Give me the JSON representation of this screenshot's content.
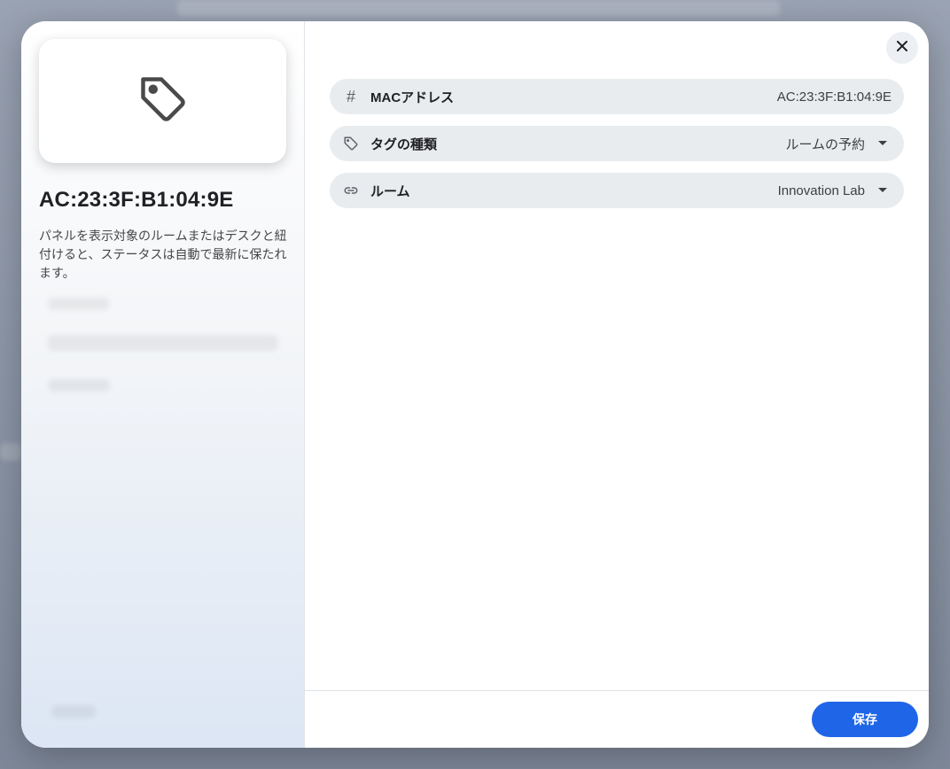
{
  "left": {
    "preview_icon": "tag-icon",
    "title": "AC:23:3F:B1:04:9E",
    "description": "パネルを表示対象のルームまたはデスクと紐付けると、ステータスは自動で最新に保たれます。"
  },
  "fields": [
    {
      "icon": "hash-icon",
      "label": "MACアドレス",
      "value": "AC:23:3F:B1:04:9E",
      "dropdown": false
    },
    {
      "icon": "tag-icon",
      "label": "タグの種類",
      "value": "ルームの予約",
      "dropdown": true
    },
    {
      "icon": "link-icon",
      "label": "ルーム",
      "value": "Innovation Lab",
      "dropdown": true
    }
  ],
  "footer": {
    "save_label": "保存"
  },
  "colors": {
    "accent": "#1f65e8",
    "row_bg": "#e9ecef"
  }
}
